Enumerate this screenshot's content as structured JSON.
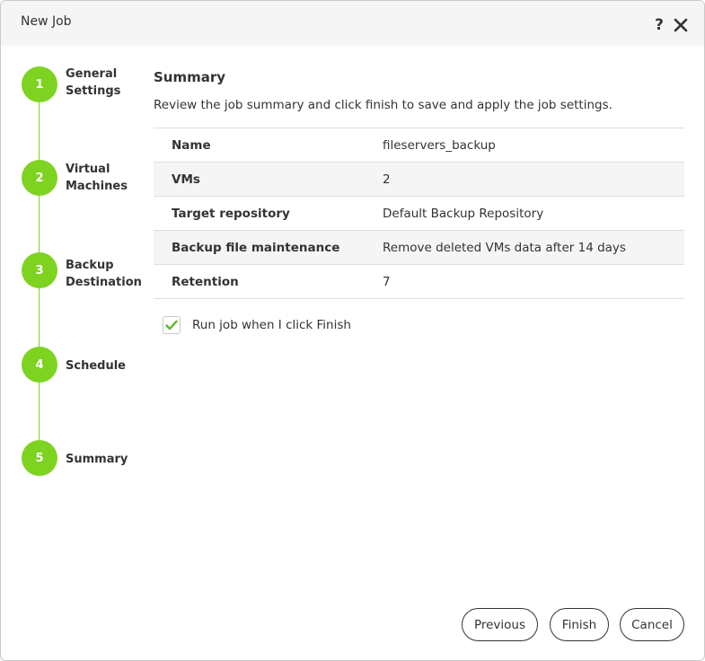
{
  "window": {
    "title": "New Job",
    "help_symbol": "?"
  },
  "steps": [
    {
      "number": "1",
      "label": "General\nSettings"
    },
    {
      "number": "2",
      "label": "Virtual\nMachines"
    },
    {
      "number": "3",
      "label": "Backup\nDestination"
    },
    {
      "number": "4",
      "label": "Schedule"
    },
    {
      "number": "5",
      "label": "Summary"
    }
  ],
  "main": {
    "title": "Summary",
    "description": "Review the job summary and click finish to save and apply the job settings.",
    "rows": [
      {
        "key": "Name",
        "value": "fileservers_backup"
      },
      {
        "key": "VMs",
        "value": "2"
      },
      {
        "key": "Target repository",
        "value": "Default Backup Repository"
      },
      {
        "key": "Backup file maintenance",
        "value": "Remove deleted VMs data after 14 days"
      },
      {
        "key": "Retention",
        "value": "7"
      }
    ],
    "run_job_checkbox": {
      "label": "Run job when I click Finish",
      "checked": true
    }
  },
  "buttons": {
    "previous": "Previous",
    "finish": "Finish",
    "cancel": "Cancel"
  },
  "colors": {
    "accent": "#7ed321",
    "check": "#5cb82a"
  }
}
